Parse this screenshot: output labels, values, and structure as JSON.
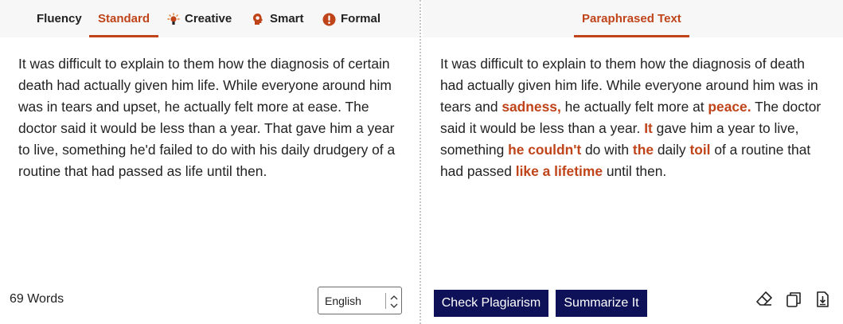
{
  "modes": {
    "tabs": [
      {
        "label": "Fluency"
      },
      {
        "label": "Standard"
      },
      {
        "label": "Creative"
      },
      {
        "label": "Smart"
      },
      {
        "label": "Formal"
      }
    ],
    "active": "Standard"
  },
  "input": {
    "text": "It was difficult to explain to them how the diagnosis of certain death had actually given him life. While everyone around him was in tears and upset, he actually felt more at ease. The doctor said it would be less than a year. That gave him a year to live, something he'd failed to do with his daily drudgery of a routine that had passed as life until then.",
    "word_count": "69 Words",
    "language": "English"
  },
  "output": {
    "tab_label": "Paraphrased Text",
    "segments": [
      {
        "t": "It was difficult to explain to them how the diagnosis of death had actually given him life. While everyone around him was in tears and "
      },
      {
        "t": "sadness,",
        "hl": true
      },
      {
        "t": " he actually felt more at "
      },
      {
        "t": "peace.",
        "hl": true
      },
      {
        "t": " The doctor said it would be less than a year. "
      },
      {
        "t": "It",
        "hl": true
      },
      {
        "t": " gave him a year to live, something "
      },
      {
        "t": "he couldn't",
        "hl": true
      },
      {
        "t": " do with "
      },
      {
        "t": "the",
        "hl": true
      },
      {
        "t": " daily "
      },
      {
        "t": "toil",
        "hl": true
      },
      {
        "t": " of a routine that had passed "
      },
      {
        "t": "like a lifetime",
        "hl": true
      },
      {
        "t": " until then."
      }
    ]
  },
  "actions": {
    "check_plagiarism": "Check Plagiarism",
    "summarize": "Summarize It"
  },
  "icons": {
    "creative": "lightbulb-icon",
    "smart": "brain-head-icon",
    "formal": "exclamation-badge-icon",
    "clear": "eraser-icon",
    "copy": "copy-icon",
    "download": "download-icon"
  },
  "colors": {
    "accent": "#c0441a",
    "button": "#0e1157"
  }
}
